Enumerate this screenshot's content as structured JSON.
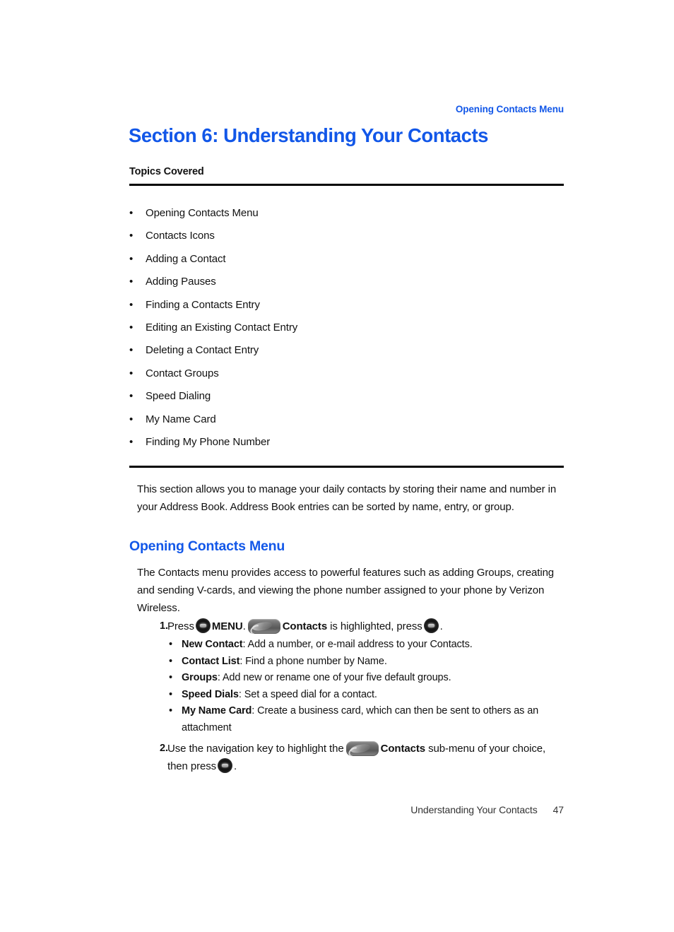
{
  "running_head": "Opening Contacts Menu",
  "section_title": "Section 6: Understanding Your Contacts",
  "topics": {
    "label": "Topics Covered",
    "items": [
      "Opening Contacts Menu",
      "Contacts Icons",
      "Adding a Contact",
      "Adding Pauses",
      "Finding a Contacts Entry",
      "Editing an Existing Contact Entry",
      "Deleting a Contact Entry",
      "Contact Groups",
      "Speed Dialing",
      "My Name Card",
      "Finding My Phone Number"
    ]
  },
  "intro_paragraph": "This section allows you to manage your daily contacts by storing their name and number in your Address Book. Address Book entries can be sorted by name, entry, or group.",
  "sub_heading": "Opening Contacts Menu",
  "body_paragraph": "The Contacts menu provides access to powerful features such as adding Groups, creating and sending V-cards, and viewing the phone number assigned to your phone by Verizon Wireless.",
  "steps": {
    "step1": {
      "number": "1.",
      "text_before_key": "Press",
      "menu_label": "MENU",
      "period_after_menu": ".",
      "contacts_label": "Contacts",
      "text_after_contacts": "is highlighted, press",
      "text_end": ".",
      "ok_key_icon": "ok-key-icon",
      "soft_key_icon": "contacts-soft-key-icon",
      "sub_items": [
        {
          "term": "New Contact",
          "desc": ": Add a number, or e-mail address to your Contacts."
        },
        {
          "term": "Contact List",
          "desc": ": Find a phone number by Name."
        },
        {
          "term": "Groups",
          "desc": ": Add new or rename one of your five default groups."
        },
        {
          "term": "Speed Dials",
          "desc": ": Set a speed dial for a contact."
        },
        {
          "term": "My Name Card",
          "desc": ": Create a business card, which can then be sent to others as an attachment"
        }
      ]
    },
    "step2": {
      "number": "2.",
      "text_before_key": "Use the navigation key to highlight the",
      "contacts_label": "Contacts",
      "text_after_contacts": "sub-menu of your choice, then press",
      "text_end": ".",
      "ok_key_icon": "ok-key-icon",
      "soft_key_icon": "contacts-soft-key-icon"
    }
  },
  "footer": {
    "title": "Understanding Your Contacts",
    "page_number": "47"
  },
  "colors": {
    "heading_blue": "#1257e8",
    "body_black": "#111111",
    "rule_black": "#000000"
  }
}
